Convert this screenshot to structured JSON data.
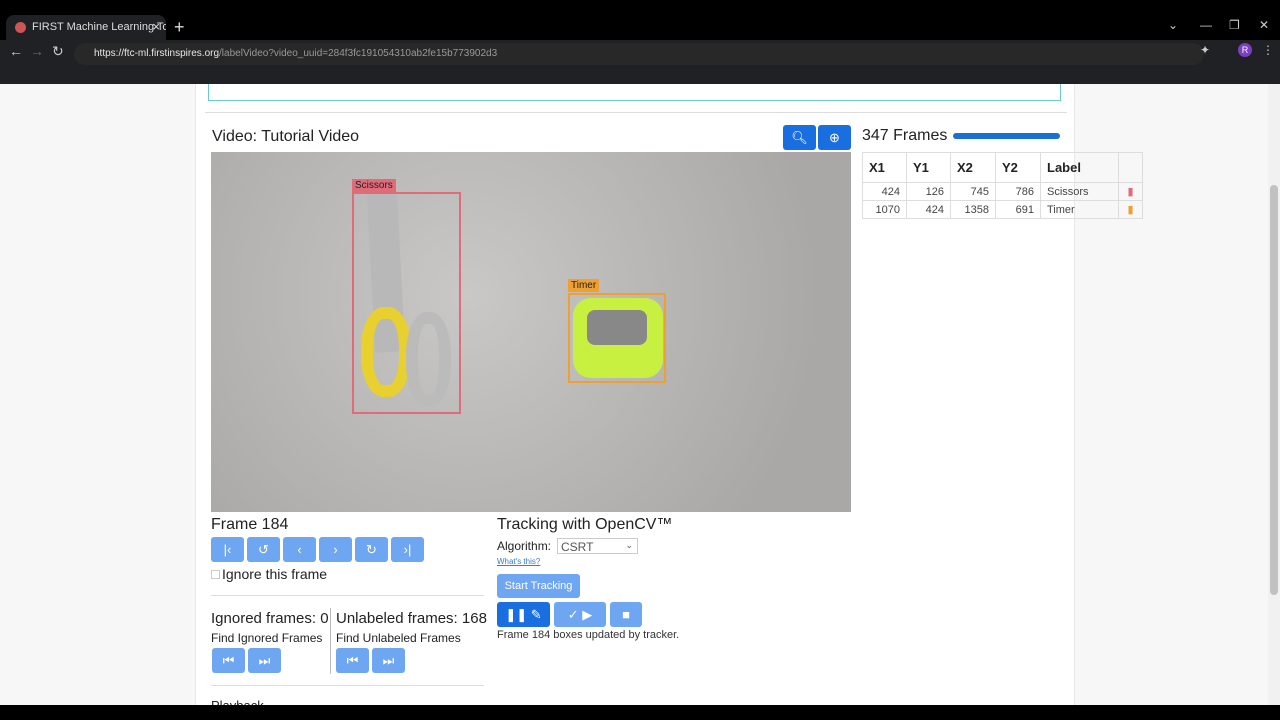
{
  "browser": {
    "tab_title": "FIRST Machine Learning Toolchain",
    "url_host": "https://ftc-ml.firstinspires.org",
    "url_path": "/labelVideo?video_uuid=284f3fc191054310ab2fe15b773902d3"
  },
  "video": {
    "title": "Video: Tutorial Video",
    "frames_label": "347 Frames",
    "progress": 1.0
  },
  "boxes_table": {
    "headers": [
      "X1",
      "Y1",
      "X2",
      "Y2",
      "Label",
      ""
    ],
    "rows": [
      {
        "x1": "424",
        "y1": "126",
        "x2": "745",
        "y2": "786",
        "label": "Scissors",
        "color": "#e06c7a"
      },
      {
        "x1": "1070",
        "y1": "424",
        "x2": "1358",
        "y2": "691",
        "label": "Timer",
        "color": "#f0a030"
      }
    ]
  },
  "frame": {
    "label": "Frame 184",
    "ignore_label": "Ignore this frame"
  },
  "ignored": {
    "label": "Ignored frames: 0",
    "find": "Find Ignored Frames"
  },
  "unlabeled": {
    "label": "Unlabeled frames: 168",
    "find": "Find Unlabeled Frames"
  },
  "playback": {
    "label": "Playback"
  },
  "tracking": {
    "title": "Tracking with OpenCV™",
    "algorithm_label": "Algorithm:",
    "algorithm": "CSRT",
    "whats_this": "What's this?",
    "start": "Start Tracking",
    "status": "Frame 184 boxes updated by tracker."
  }
}
